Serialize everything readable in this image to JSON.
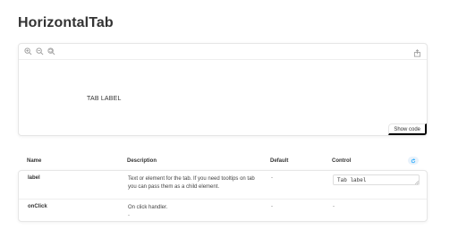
{
  "page": {
    "title": "HorizontalTab"
  },
  "preview": {
    "toolbar": {
      "icons": [
        "zoom-in-icon",
        "zoom-out-icon",
        "zoom-reset-icon",
        "share-icon"
      ]
    },
    "tab_label": "TAB LABEL",
    "show_code_label": "Show code"
  },
  "args_table": {
    "headers": {
      "name": "Name",
      "description": "Description",
      "default": "Default",
      "control": "Control"
    },
    "reset_icon": "reset-icon",
    "rows": [
      {
        "name": "label",
        "description": "Text or element for the tab. If you need tooltips on tab you can pass them as a child element.",
        "default": "-",
        "control_value": "Tab label"
      },
      {
        "name": "onClick",
        "description": "On click handler.",
        "sub": "-",
        "default": "-",
        "control_value": "-"
      }
    ]
  },
  "colors": {
    "text": "#333333",
    "border": "#e6e6e6",
    "icon": "#999999",
    "accent": "#1ea7fd"
  }
}
